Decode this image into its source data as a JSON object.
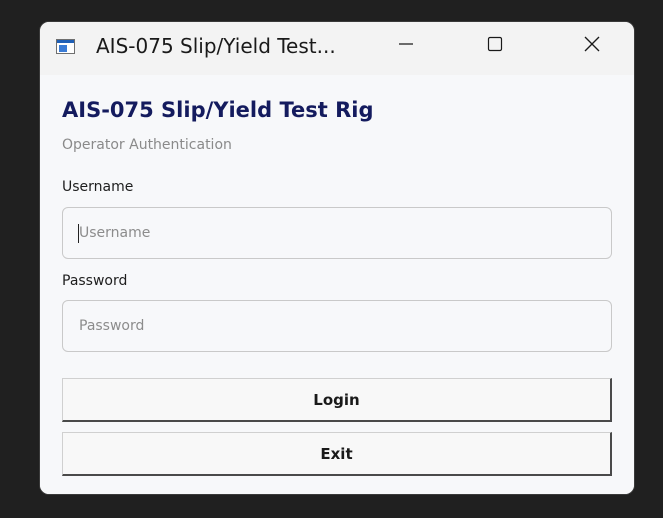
{
  "window": {
    "title": "AIS-075 Slip/Yield Test...",
    "controls": [
      "minimize-icon",
      "maximize-icon",
      "close-icon"
    ]
  },
  "form": {
    "heading": "AIS-075 Slip/Yield Test Rig",
    "subheading": "Operator Authentication",
    "username_label": "Username",
    "username_value": "",
    "username_placeholder": "Username",
    "password_label": "Password",
    "password_value": "",
    "password_placeholder": "Password",
    "login_label": "Login",
    "exit_label": "Exit"
  },
  "colors": {
    "heading": "#141b5e",
    "subheading": "#8a8a8a",
    "background": "#f7f8fa"
  }
}
